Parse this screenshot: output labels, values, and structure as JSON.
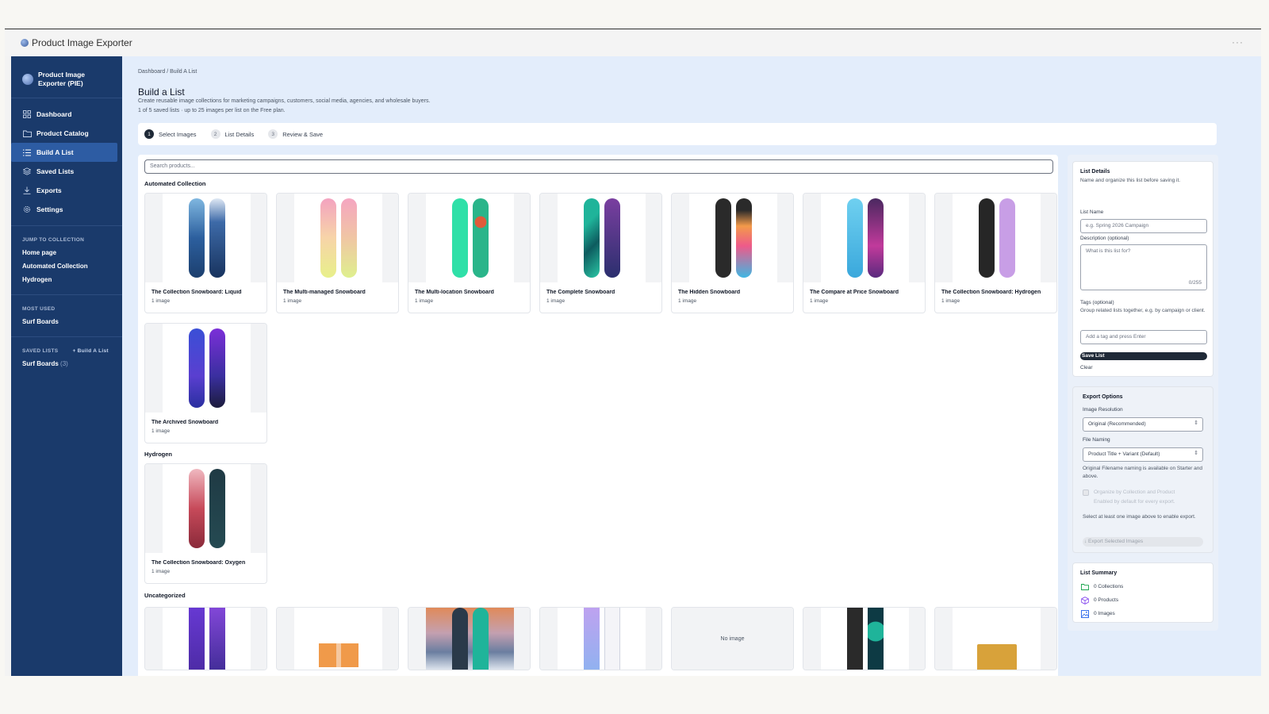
{
  "app": {
    "title": "Product Image Exporter"
  },
  "sidebar": {
    "brand": "Product Image Exporter (PIE)",
    "nav": [
      {
        "label": "Dashboard",
        "icon": "grid-icon"
      },
      {
        "label": "Product Catalog",
        "icon": "folder-icon"
      },
      {
        "label": "Build A List",
        "icon": "list-icon",
        "active": true
      },
      {
        "label": "Saved Lists",
        "icon": "layers-icon"
      },
      {
        "label": "Exports",
        "icon": "download-icon"
      },
      {
        "label": "Settings",
        "icon": "gear-icon"
      }
    ],
    "jump_heading": "JUMP TO COLLECTION",
    "jump_links": [
      "Home page",
      "Automated Collection",
      "Hydrogen"
    ],
    "most_used_heading": "MOST USED",
    "most_used_links": [
      "Surf Boards"
    ],
    "saved_heading": "SAVED LISTS",
    "saved_build_link": "+ Build A List",
    "saved_link": "Surf Boards",
    "saved_count": "(3)"
  },
  "main": {
    "breadcrumb": "Dashboard / Build A List",
    "title": "Build a List",
    "description": "Create reusable image collections for marketing campaigns, customers, social media, agencies, and wholesale buyers.",
    "subtext": "1 of 5 saved lists · up to 25 images per list on the Free plan.",
    "steps": [
      {
        "num": "1",
        "label": "Select Images"
      },
      {
        "num": "2",
        "label": "List Details"
      },
      {
        "num": "3",
        "label": "Review & Save"
      }
    ],
    "search_placeholder": "Search products...",
    "sections": {
      "automated": "Automated Collection",
      "hydrogen": "Hydrogen",
      "uncategorized": "Uncategorized"
    },
    "automated_cards": [
      {
        "title": "The Collection Snowboard: Liquid",
        "meta": "1 image"
      },
      {
        "title": "The Multi-managed Snowboard",
        "meta": "1 image"
      },
      {
        "title": "The Multi-location Snowboard",
        "meta": "1 image"
      },
      {
        "title": "The Complete Snowboard",
        "meta": "1 image"
      },
      {
        "title": "The Hidden Snowboard",
        "meta": "1 image"
      },
      {
        "title": "The Compare at Price Snowboard",
        "meta": "1 image"
      },
      {
        "title": "The Collection Snowboard: Hydrogen",
        "meta": "1 image"
      },
      {
        "title": "The Archived Snowboard",
        "meta": "1 image"
      }
    ],
    "hydrogen_cards": [
      {
        "title": "The Collection Snowboard: Oxygen",
        "meta": "1 image"
      }
    ],
    "no_image": "No image"
  },
  "list_details": {
    "title": "List Details",
    "help": "Name and organize this list before saving it.",
    "name_label": "List Name",
    "name_placeholder": "e.g. Spring 2026 Campaign",
    "desc_label": "Description (optional)",
    "desc_placeholder": "What is this list for?",
    "desc_counter": "0/255",
    "tags_label": "Tags (optional)",
    "tags_help": "Group related lists together, e.g. by campaign or client.",
    "tags_placeholder": "Add a tag and press Enter",
    "save_label": "Save List",
    "clear_label": "Clear"
  },
  "export_options": {
    "title": "Export Options",
    "resolution_label": "Image Resolution",
    "resolution_value": "Original (Recommended)",
    "naming_label": "File Naming",
    "naming_value": "Product Title + Variant (Default)",
    "naming_help": "Original Filename naming is available on Starter and above.",
    "organize_label": "Organize by Collection and Product",
    "organize_help": "Enabled by default for every export.",
    "select_help": "Select at least one image above to enable export.",
    "export_label": "↓ Export Selected Images"
  },
  "summary": {
    "title": "List Summary",
    "collections": "0 Collections",
    "products": "0 Products",
    "images": "0 Images"
  }
}
